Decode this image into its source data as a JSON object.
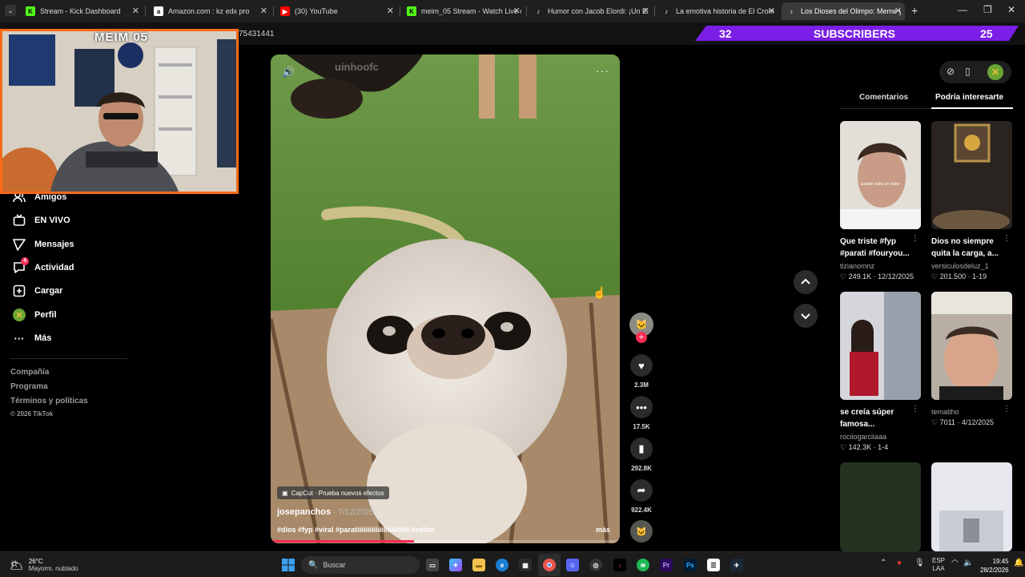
{
  "browser": {
    "tabs": [
      {
        "title": "Stream - Kick Dashboard",
        "icon": "kick-icon",
        "color": "#53fc18"
      },
      {
        "title": "Amazon.com : kz edx pro",
        "icon": "amazon-icon",
        "color": "#ffffff"
      },
      {
        "title": "(30) YouTube",
        "icon": "youtube-icon",
        "color": "#ff0000"
      },
      {
        "title": "meim_05 Stream - Watch Live o",
        "icon": "kick-icon",
        "color": "#53fc18"
      },
      {
        "title": "Humor con Jacob Elordi: ¡Un Ex",
        "icon": "tiktok-icon",
        "color": "#ffffff"
      },
      {
        "title": "La emotiva historia de El Crom",
        "icon": "tiktok-icon",
        "color": "#ffffff"
      },
      {
        "title": "Los Dioses del Olimpo: Meme y",
        "icon": "tiktok-icon",
        "color": "#ffffff",
        "active": true
      }
    ],
    "partial_url": "75431441"
  },
  "overlay": {
    "webcam_title": "MEIM 05",
    "subs_left": "32",
    "subs_label": "SUBSCRIBERS",
    "subs_right": "25",
    "accent": "#7b1ee6",
    "cam_border": "#ff6a1a"
  },
  "sidebar": {
    "items": [
      {
        "label": "Amigos",
        "icon": "friends-icon"
      },
      {
        "label": "EN VIVO",
        "icon": "live-icon"
      },
      {
        "label": "Mensajes",
        "icon": "messages-icon"
      },
      {
        "label": "Actividad",
        "icon": "activity-icon",
        "badge": "4"
      },
      {
        "label": "Cargar",
        "icon": "upload-icon"
      },
      {
        "label": "Perfil",
        "icon": "profile-icon"
      },
      {
        "label": "Más",
        "icon": "more-icon"
      }
    ],
    "footer": [
      "Compañía",
      "Programa",
      "Términos y políticas"
    ],
    "copyright": "© 2026 TikTok"
  },
  "video": {
    "author": "josepanchos",
    "date": "· 7/12/2025",
    "capcut": "CapCut · Prueba nuevos efectos",
    "caption": "#dios #fyp #viral #paratiiiiiiiiiiiiiiiiiiiiiiiiii #editar",
    "more": "más",
    "watermark": "uinhoofc",
    "progress": 0.41
  },
  "actions": {
    "likes": "2.3M",
    "comments": "17.5K",
    "saves": "292.8K",
    "shares": "922.4K"
  },
  "panel": {
    "tab_comments": "Comentarios",
    "tab_suggested": "Podría interesarte",
    "cards": [
      {
        "title": "Que triste #fyp #parati #fouryou...",
        "user": "tizianomnz",
        "likes": "249.1K",
        "date": "12/12/2025",
        "bg": "#cfcac4"
      },
      {
        "title": "Dios no siempre quita la carga, a...",
        "user": "versiculosdeluz_1",
        "likes": "201.500",
        "date": "1-19",
        "bg": "#2c2722"
      },
      {
        "title": "se creía súper famosa...",
        "user": "rociiogarciiaaa",
        "likes": "142.3K",
        "date": "1-4",
        "bg": "#d8d8dc"
      },
      {
        "title": "",
        "user": "tematiho",
        "likes": "7011",
        "date": "4/12/2025",
        "bg": "#b9b1a8"
      },
      {
        "title": "",
        "user": "",
        "likes": "",
        "date": "",
        "bg": "#243520"
      },
      {
        "title": "",
        "user": "",
        "likes": "",
        "date": "",
        "bg": "#e4e6ec"
      }
    ]
  },
  "taskbar": {
    "weather_temp": "26°C",
    "weather_desc": "Mayorm. nublado",
    "search": "Buscar",
    "lang": "ESP",
    "lang2": "LAA",
    "time": "19:45",
    "date": "28/2/2026"
  }
}
